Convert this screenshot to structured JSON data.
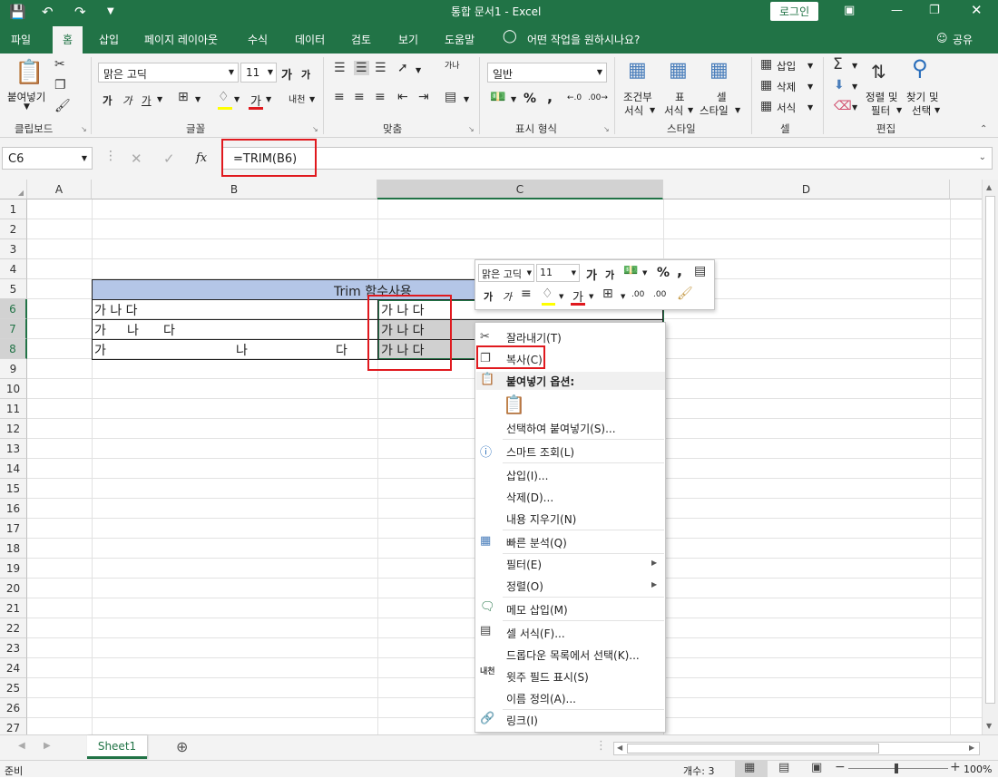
{
  "titlebar": {
    "title": "통합 문서1  -  Excel",
    "login_label": "로그인",
    "bg_color": "#217346"
  },
  "tabs": [
    "파일",
    "홈",
    "삽입",
    "페이지 레이아웃",
    "수식",
    "데이터",
    "검토",
    "보기",
    "도움말"
  ],
  "active_tab": "홈",
  "tell_me": "어떤 작업을 원하시나요?",
  "share_label": "공유",
  "ribbon": {
    "clipboard": {
      "paste_label": "붙여넣기",
      "group_label": "클립보드"
    },
    "font": {
      "font_name": "맑은 고딕",
      "font_size": "11",
      "bold": "가",
      "italic": "가",
      "underline": "가",
      "font_color": "가",
      "phonetic": "내천",
      "grow": "가",
      "shrink": "가",
      "group_label": "글꼴"
    },
    "alignment": {
      "wrap": "가나",
      "group_label": "맞춤"
    },
    "number": {
      "format": "일반",
      "percent": "%",
      "comma": ",",
      "group_label": "표시 형식"
    },
    "styles": {
      "cond_line1": "조건부",
      "cond_line2": "서식",
      "table_line1": "표",
      "table_line2": "서식",
      "cell_line1": "셀",
      "cell_line2": "스타일",
      "group_label": "스타일"
    },
    "cells": {
      "insert": "삽입",
      "delete": "삭제",
      "format": "서식",
      "group_label": "셀"
    },
    "editing": {
      "sort_line1": "정렬 및",
      "sort_line2": "필터",
      "find_line1": "찾기 및",
      "find_line2": "선택",
      "group_label": "편집"
    }
  },
  "formula_bar": {
    "name_box": "C6",
    "fx": "fx",
    "formula": "=TRIM(B6)"
  },
  "columns": [
    "A",
    "B",
    "C",
    "D"
  ],
  "rows": [
    "1",
    "2",
    "3",
    "4",
    "5",
    "6",
    "7",
    "8",
    "9",
    "10",
    "11",
    "12",
    "13",
    "14",
    "15",
    "16",
    "17",
    "18",
    "19",
    "20",
    "21",
    "22",
    "23",
    "24",
    "25",
    "26",
    "27"
  ],
  "table": {
    "header": "Trim 함수사용",
    "b6": "가 나 다",
    "b7_parts": [
      "가",
      "나",
      "다"
    ],
    "b8_parts": [
      "가",
      "나",
      "다"
    ],
    "c6": "가 나 다",
    "c7": "가 나 다",
    "c8": "가 나 다",
    "header_color": "#b4c6e7"
  },
  "mini_toolbar": {
    "font_name": "맑은 고딕",
    "font_size": "11",
    "grow": "가",
    "shrink": "가",
    "percent": "%",
    "comma": ",",
    "bold": "가",
    "italic": "가",
    "font_color": "가",
    "dec_inc": ".00",
    "dec_dec": ".00"
  },
  "context_menu": {
    "cut": "잘라내기(T)",
    "copy": "복사(C)",
    "paste_options": "붙여넣기 옵션:",
    "paste_special": "선택하여 붙여넣기(S)...",
    "smart_lookup": "스마트 조회(L)",
    "insert": "삽입(I)...",
    "delete": "삭제(D)...",
    "clear": "내용 지우기(N)",
    "quick_analysis": "빠른 분석(Q)",
    "filter": "필터(E)",
    "sort": "정렬(O)",
    "comment": "메모 삽입(M)",
    "format_cells": "셀 서식(F)...",
    "dropdown": "드롭다운 목록에서 선택(K)...",
    "phonetic": "윗주 필드 표시(S)",
    "define_name": "이름 정의(A)...",
    "link": "링크(I)",
    "phonetic_icon": "내천"
  },
  "sheet_tab": "Sheet1",
  "status": {
    "ready": "준비",
    "count": "개수: 3",
    "zoom": "100%"
  },
  "highlight_color": "#e0191e"
}
